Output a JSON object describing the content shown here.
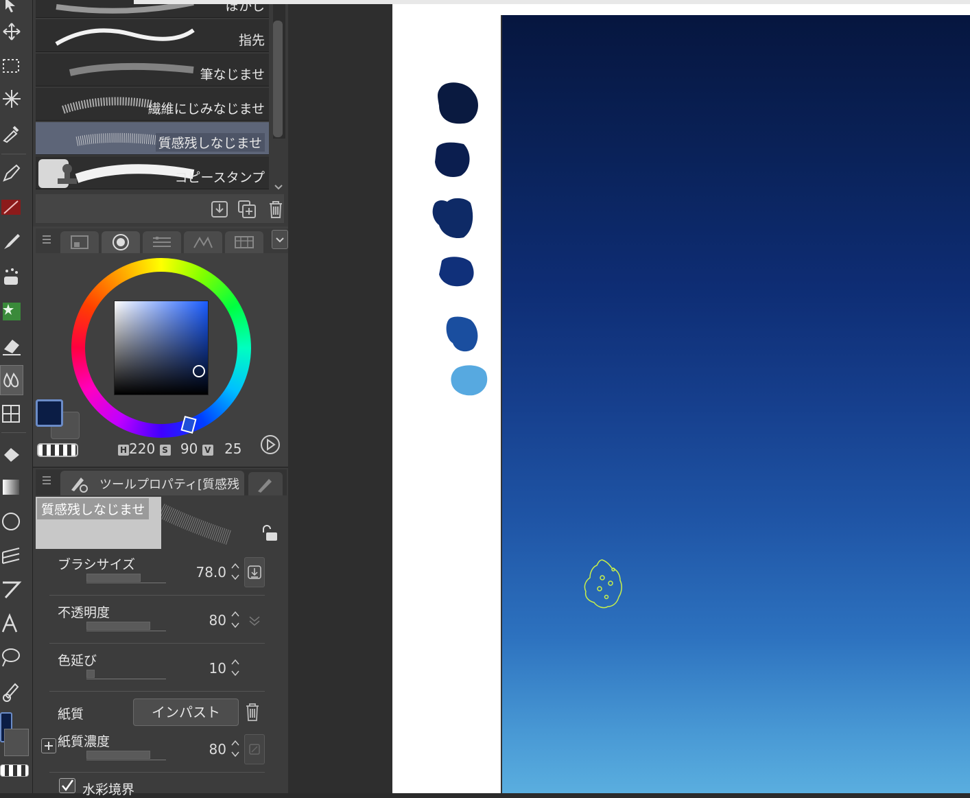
{
  "brushes": [
    {
      "label": "ぼかし"
    },
    {
      "label": "指先"
    },
    {
      "label": "筆なじませ"
    },
    {
      "label": "繊維にじみなじませ"
    },
    {
      "label": "質感残しなじませ",
      "selected": true
    },
    {
      "label": "コピースタンプ"
    }
  ],
  "color": {
    "h_key": "H",
    "h": "220",
    "s_key": "S",
    "s": "90",
    "v_key": "V",
    "v": "25",
    "main_color": "#0b1d45",
    "sub_color": "#505050"
  },
  "tool_property": {
    "title": "ツールプロパティ[質感残",
    "preview_name": "質感残しなじませ",
    "brush_size_label": "ブラシサイズ",
    "brush_size_value": "78.0",
    "brush_size_fraction": 0.68,
    "opacity_label": "不透明度",
    "opacity_value": "80",
    "opacity_fraction": 0.8,
    "color_stretch_label": "色延び",
    "color_stretch_value": "10",
    "color_stretch_fraction": 0.1,
    "paper_label": "紙質",
    "paper_button": "インパスト",
    "paper_density_label": "紙質濃度",
    "paper_density_value": "80",
    "paper_density_fraction": 0.8,
    "watercolor_edge_label": "水彩境界"
  },
  "swatches": [
    "#0a1a40",
    "#0b1e4f",
    "#0e2a66",
    "#10307a",
    "#1a4e9f",
    "#57a9e0"
  ],
  "accent_colors": {
    "selection_outline": "#c8f04a",
    "selected_brush_bg": "#5d6578"
  }
}
